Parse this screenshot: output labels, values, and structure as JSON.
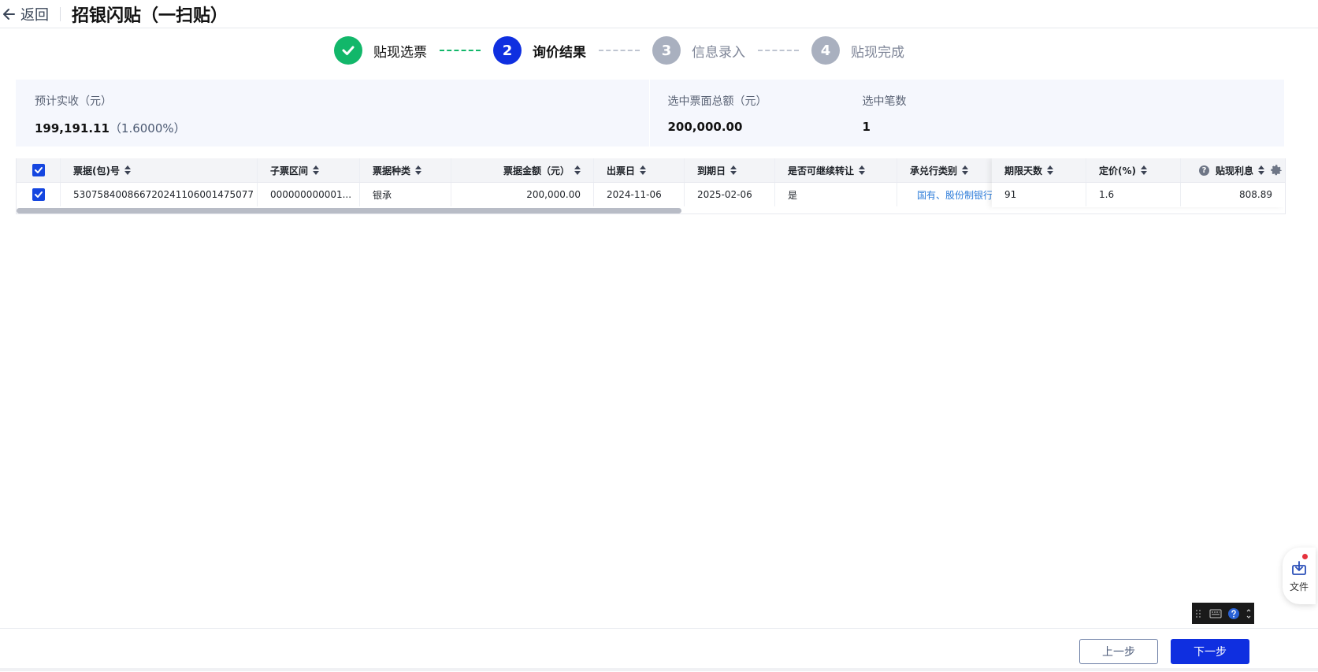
{
  "header": {
    "back_label": "返回",
    "title": "招银闪贴（一扫贴）"
  },
  "steps": [
    {
      "index": "1",
      "label": "贴现选票",
      "state": "done"
    },
    {
      "index": "2",
      "label": "询价结果",
      "state": "active"
    },
    {
      "index": "3",
      "label": "信息录入",
      "state": "pending"
    },
    {
      "index": "4",
      "label": "贴现完成",
      "state": "pending"
    }
  ],
  "summary": {
    "estimated_label": "预计实收（元）",
    "estimated_value": "199,191.11",
    "estimated_rate": "（1.6000%）",
    "total_label": "选中票面总额（元）",
    "total_value": "200,000.00",
    "count_label": "选中笔数",
    "count_value": "1"
  },
  "table": {
    "headers": {
      "bill_no": "票据(包)号",
      "sub_range": "子票区间",
      "bill_type": "票据种类",
      "amount": "票据金额（元）",
      "issue_date": "出票日",
      "due_date": "到期日",
      "transferable": "是否可继续转让",
      "acceptor_type": "承兑行类别",
      "days": "期限天数",
      "price": "定价(%)",
      "interest": "贴现利息"
    },
    "row": {
      "bill_no": "530758400866720241106001475077",
      "sub_range": "000000000001...",
      "bill_type": "银承",
      "amount": "200,000.00",
      "issue_date": "2024-11-06",
      "due_date": "2025-02-06",
      "transferable": "是",
      "acceptor_type": "国有、股份制银行",
      "days": "91",
      "price": "1.6",
      "interest": "808.89"
    }
  },
  "file_widget": {
    "label": "文件"
  },
  "footer": {
    "prev_label": "上一步",
    "next_label": "下一步"
  },
  "colors": {
    "primary": "#0f2fe0",
    "success": "#12b76a",
    "pending": "#a9b0bf"
  }
}
